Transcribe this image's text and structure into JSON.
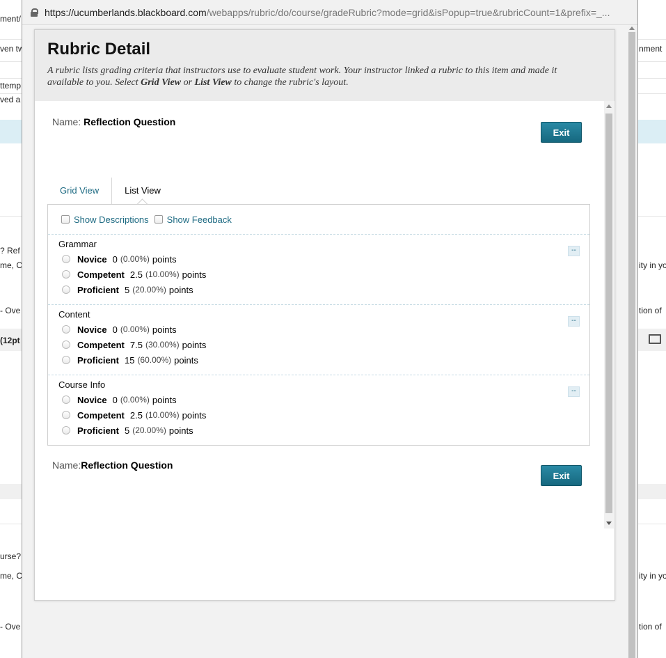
{
  "browser": {
    "url_host": "https://ucumberlands.blackboard.com",
    "url_path": "/webapps/rubric/do/course/gradeRubric?mode=grid&isPopup=true&rubricCount=1&prefix=_..."
  },
  "background": {
    "left_fragments": [
      "ment/",
      "ven tw",
      "ttemp",
      "ved a",
      "? Ref",
      "me, C",
      "- Ove",
      "(12pt",
      "urse?",
      "me, C",
      "- Ove"
    ],
    "right_fragments": [
      "nment",
      "ity in yo",
      "tion of",
      "ity in yo",
      "tion of"
    ]
  },
  "rubric": {
    "title": "Rubric Detail",
    "intro_part1": "A rubric lists grading criteria that instructors use to evaluate student work. Your instructor linked a rubric to this item and made it available to you. Select ",
    "intro_grid": "Grid View",
    "intro_or": " or ",
    "intro_list": "List View",
    "intro_part2": " to change the rubric's layout.",
    "name_label": "Name:",
    "name_value": "Reflection Question",
    "exit_label": "Exit",
    "tabs": [
      "Grid View",
      "List View"
    ],
    "show_descriptions": "Show Descriptions",
    "show_feedback": "Show Feedback",
    "collapse_label": "--",
    "criteria": [
      {
        "title": "Grammar",
        "levels": [
          {
            "name": "Novice",
            "score": "0",
            "pct": "(0.00%)",
            "unit": "points"
          },
          {
            "name": "Competent",
            "score": "2.5",
            "pct": "(10.00%)",
            "unit": "points"
          },
          {
            "name": "Proficient",
            "score": "5",
            "pct": "(20.00%)",
            "unit": "points"
          }
        ]
      },
      {
        "title": "Content",
        "levels": [
          {
            "name": "Novice",
            "score": "0",
            "pct": "(0.00%)",
            "unit": "points"
          },
          {
            "name": "Competent",
            "score": "7.5",
            "pct": "(30.00%)",
            "unit": "points"
          },
          {
            "name": "Proficient",
            "score": "15",
            "pct": "(60.00%)",
            "unit": "points"
          }
        ]
      },
      {
        "title": "Course Info",
        "levels": [
          {
            "name": "Novice",
            "score": "0",
            "pct": "(0.00%)",
            "unit": "points"
          },
          {
            "name": "Competent",
            "score": "2.5",
            "pct": "(10.00%)",
            "unit": "points"
          },
          {
            "name": "Proficient",
            "score": "5",
            "pct": "(20.00%)",
            "unit": "points"
          }
        ]
      }
    ],
    "footer_name_label": "Name:",
    "footer_name_value": "Reflection Question"
  },
  "colors": {
    "accent": "#1e7a94",
    "link": "#1d6a82",
    "header_bg": "#ebebeb"
  }
}
